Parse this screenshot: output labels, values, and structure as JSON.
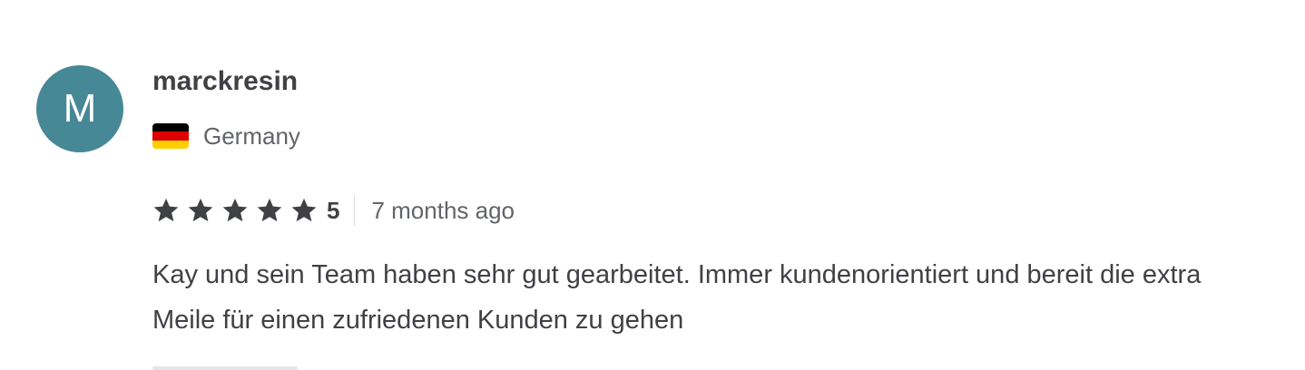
{
  "review": {
    "avatar_initial": "M",
    "avatar_color": "#468896",
    "username": "marckresin",
    "country": "Germany",
    "flag_colors": [
      "#000000",
      "#dd0000",
      "#ffce00"
    ],
    "rating": {
      "stars": 5,
      "max_stars": 5,
      "value_label": "5"
    },
    "time_ago": "7 months ago",
    "text": "Kay und sein Team haben sehr gut gearbeitet. Immer kundenorientiert und bereit die extra Meile für einen zufriedenen Kunden zu gehen"
  }
}
